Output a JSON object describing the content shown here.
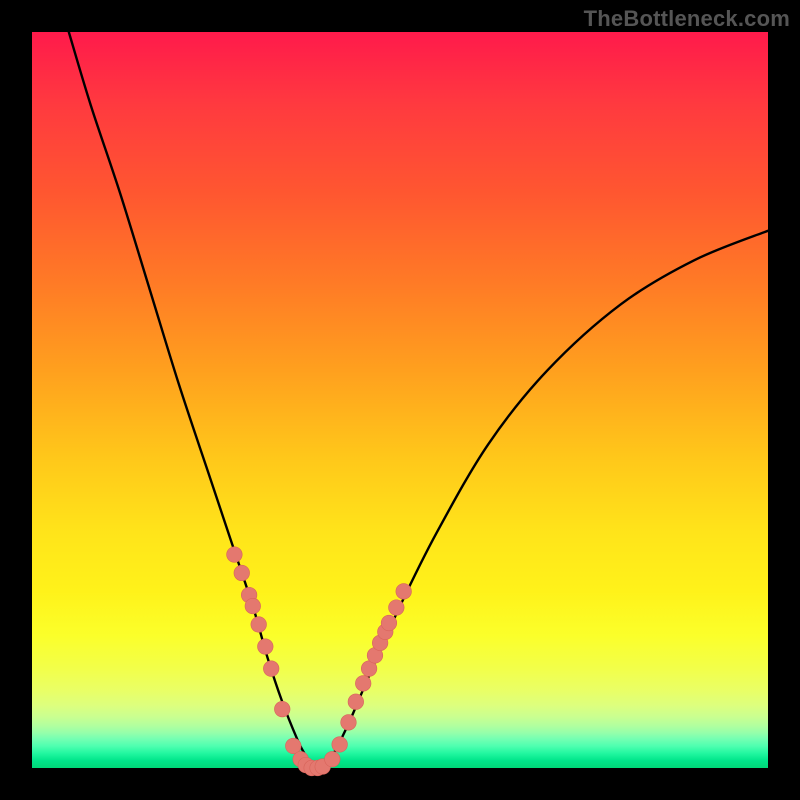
{
  "watermark": {
    "text": "TheBottleneck.com"
  },
  "colors": {
    "frame": "#000000",
    "curve_stroke": "#000000",
    "marker_fill": "#e4786f",
    "marker_stroke": "#d8645b"
  },
  "chart_data": {
    "type": "line",
    "title": "",
    "xlabel": "",
    "ylabel": "",
    "xlim": [
      0,
      100
    ],
    "ylim": [
      0,
      100
    ],
    "grid": false,
    "legend": false,
    "series": [
      {
        "name": "bottleneck-curve",
        "x": [
          5,
          8,
          12,
          16,
          20,
          24,
          27,
          30,
          32,
          34,
          36,
          37,
          38,
          39,
          40,
          41,
          43,
          46,
          50,
          55,
          62,
          70,
          80,
          90,
          100
        ],
        "y": [
          100,
          90,
          78,
          65,
          52,
          40,
          31,
          22,
          15,
          9,
          4,
          2,
          0.5,
          0,
          0.5,
          2,
          6,
          13,
          22,
          32,
          44,
          54,
          63,
          69,
          73
        ]
      }
    ],
    "markers": {
      "name": "highlighted-points",
      "x": [
        27.5,
        28.5,
        29.5,
        30.0,
        30.8,
        31.7,
        32.5,
        34.0,
        35.5,
        36.5,
        37.2,
        38.0,
        38.8,
        39.5,
        40.8,
        41.8,
        43.0,
        44.0,
        45.0,
        45.8,
        46.6,
        47.3,
        48.0,
        48.5,
        49.5,
        50.5
      ],
      "y": [
        29.0,
        26.5,
        23.5,
        22.0,
        19.5,
        16.5,
        13.5,
        8.0,
        3.0,
        1.2,
        0.4,
        0.0,
        0.0,
        0.2,
        1.2,
        3.2,
        6.2,
        9.0,
        11.5,
        13.5,
        15.3,
        17.0,
        18.5,
        19.7,
        21.8,
        24.0
      ]
    }
  }
}
